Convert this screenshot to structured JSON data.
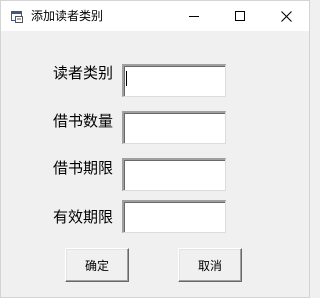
{
  "window": {
    "title": "添加读者类别",
    "icon": "app-window-icon",
    "controls": [
      "minimize-icon",
      "maximize-icon",
      "close-icon"
    ]
  },
  "form": {
    "fields": [
      {
        "label": "读者类别",
        "value": ""
      },
      {
        "label": "借书数量",
        "value": ""
      },
      {
        "label": "借书期限",
        "value": ""
      },
      {
        "label": "有效期限",
        "value": ""
      }
    ]
  },
  "buttons": {
    "ok": "确定",
    "cancel": "取消"
  }
}
